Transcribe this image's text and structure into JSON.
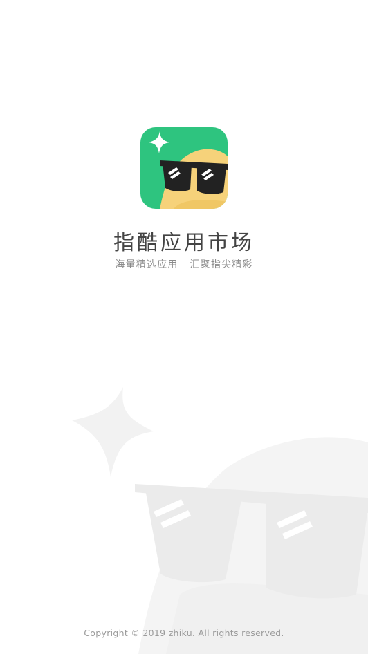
{
  "splash": {
    "app_name": "指酷应用市场",
    "slogan": "海量精选应用   汇聚指尖精彩",
    "copyright": "Copyright © 2019 zhiku. All rights reserved."
  },
  "colors": {
    "brand_green": "#2ec47f",
    "face_yellow": "#f6d27a",
    "glasses_dark": "#222222",
    "background": "#ffffff",
    "watermark_gray": "#efefef"
  },
  "icons": {
    "logo": "sunglasses-face-logo",
    "sparkle": "sparkle-icon",
    "background_art": "sunglasses-watermark"
  }
}
